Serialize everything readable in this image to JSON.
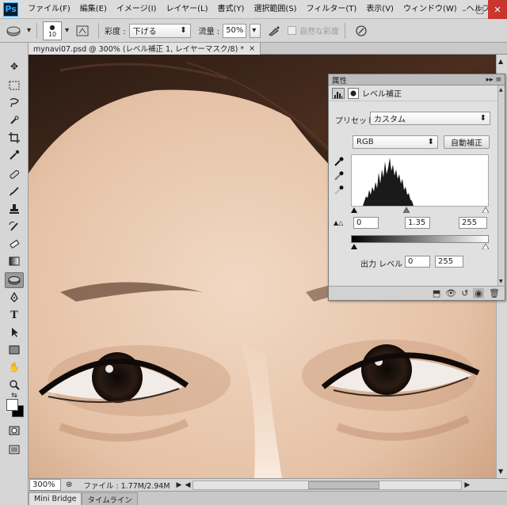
{
  "app": {
    "logo": "Ps"
  },
  "menu": [
    "ファイル(F)",
    "編集(E)",
    "イメージ(I)",
    "レイヤー(L)",
    "書式(Y)",
    "選択範囲(S)",
    "フィルター(T)",
    "表示(V)",
    "ウィンドウ(W)",
    "ヘルプ(H)"
  ],
  "window_controls": {
    "minimize": "–",
    "maximize": "□",
    "close": "✕"
  },
  "options": {
    "brush_size": "10",
    "mode_label": "彩度 :",
    "mode_value": "下げる",
    "flow_label": "流量 :",
    "flow_value": "50%",
    "vibrance_label": "自然な彩度"
  },
  "document": {
    "tab_title": "mynavi07.psd @ 300% (レベル補正 1, レイヤーマスク/8) *",
    "tab_close": "×",
    "zoom": "300%",
    "file_info": "ファイル : 1.77M/2.94M"
  },
  "bottom_tabs": [
    "Mini Bridge",
    "タイムライン"
  ],
  "properties": {
    "panel_title": "属性",
    "adjustment_name": "レベル補正",
    "preset_label": "プリセット :",
    "preset_value": "カスタム",
    "channel": "RGB",
    "auto_button": "自動補正",
    "input_black": "0",
    "input_gamma": "1.35",
    "input_white": "255",
    "output_label": "出力 レベル :",
    "output_black": "0",
    "output_white": "255"
  },
  "colors": {
    "foreground": "#ffffff",
    "background": "#000000",
    "accent": "#31a8ff"
  }
}
